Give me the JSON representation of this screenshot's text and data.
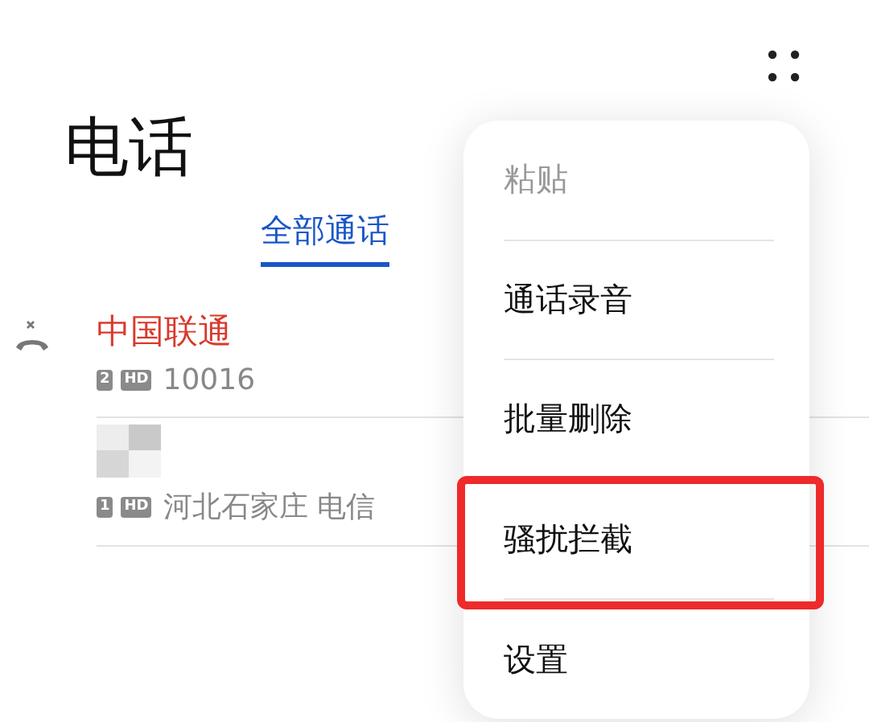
{
  "title": "电话",
  "tabs": [
    {
      "label": "全部通话",
      "selected": true
    }
  ],
  "calls": [
    {
      "name": "中国联通",
      "missed": true,
      "sim": "2",
      "hd": "HD",
      "detail": "10016"
    },
    {
      "missed": false,
      "sim": "1",
      "hd": "HD",
      "detail": "河北石家庄 电信"
    }
  ],
  "menu": {
    "items": [
      {
        "label": "粘贴",
        "disabled": true,
        "highlighted": false
      },
      {
        "label": "通话录音",
        "disabled": false,
        "highlighted": false
      },
      {
        "label": "批量删除",
        "disabled": false,
        "highlighted": false
      },
      {
        "label": "骚扰拦截",
        "disabled": false,
        "highlighted": true
      },
      {
        "label": "设置",
        "disabled": false,
        "highlighted": false
      }
    ]
  }
}
